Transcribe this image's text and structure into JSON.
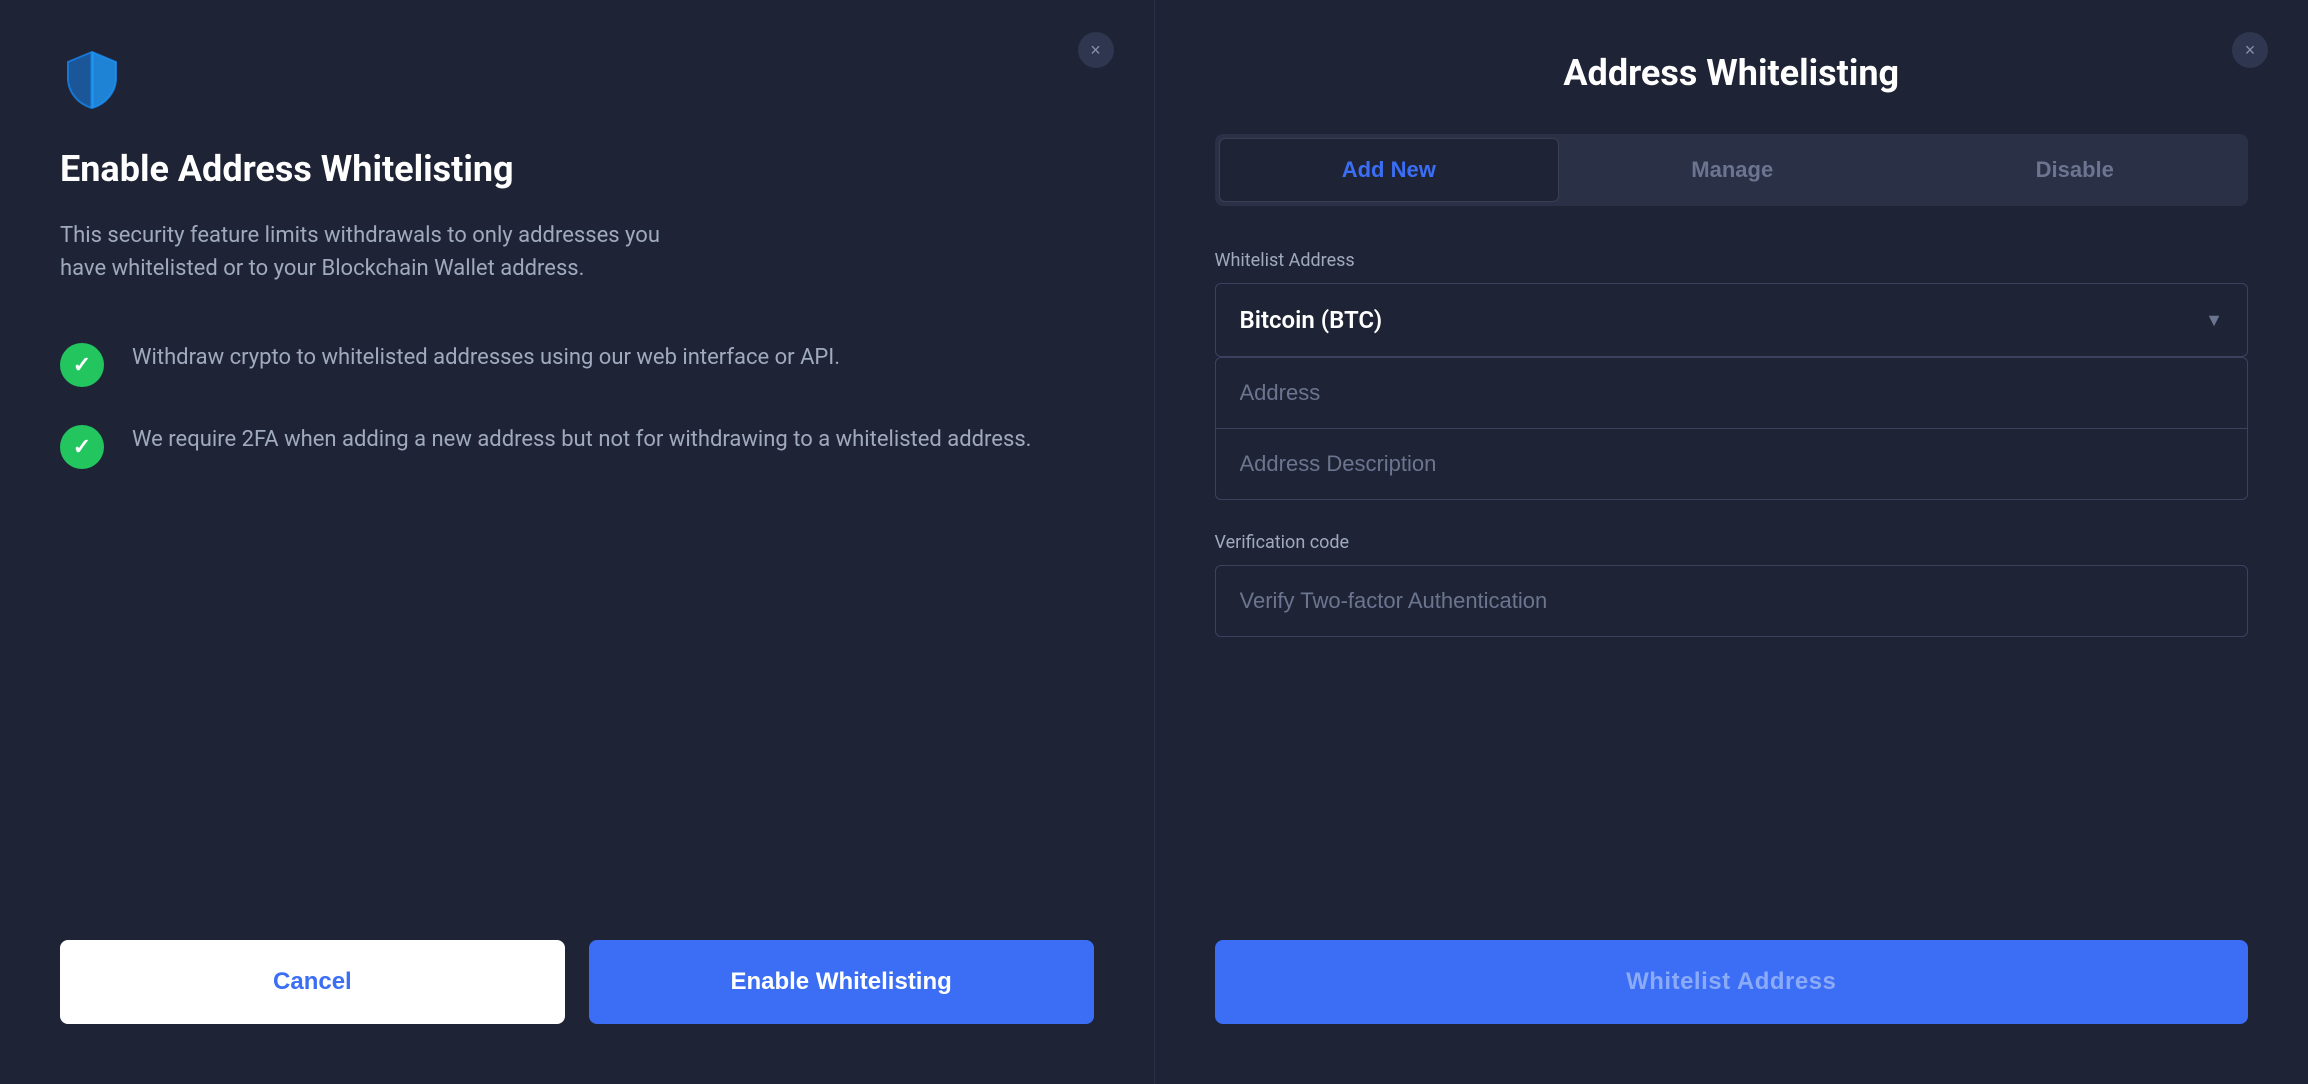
{
  "left_panel": {
    "title": "Enable Address Whitelisting",
    "description": "This security feature limits withdrawals to only addresses you have whitelisted or to your Blockchain Wallet address.",
    "features": [
      {
        "text": "Withdraw crypto to whitelisted addresses using our web interface or API."
      },
      {
        "text": "We require 2FA when adding a new address but not for withdrawing to a whitelisted address."
      }
    ],
    "cancel_label": "Cancel",
    "enable_label": "Enable Whitelisting",
    "close_label": "×"
  },
  "right_panel": {
    "title": "Address Whitelisting",
    "close_label": "×",
    "tabs": [
      {
        "label": "Add New",
        "active": true
      },
      {
        "label": "Manage",
        "active": false
      },
      {
        "label": "Disable",
        "active": false
      }
    ],
    "whitelist_address_label": "Whitelist Address",
    "currency_selected": "Bitcoin (BTC)",
    "address_placeholder": "Address",
    "address_description_placeholder": "Address Description",
    "verification_label": "Verification code",
    "verify_placeholder": "Verify Two-factor Authentication",
    "submit_label": "Whitelist Address"
  },
  "colors": {
    "accent_blue": "#3b6ef5",
    "green_check": "#22c55e",
    "bg_dark": "#1e2435",
    "text_muted": "#a0aabe",
    "text_light": "#ffffff",
    "border": "#3a4260"
  }
}
